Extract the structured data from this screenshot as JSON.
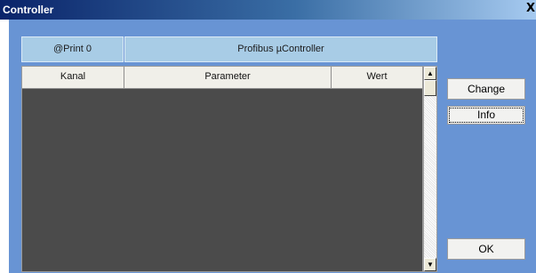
{
  "window": {
    "title": "Controller",
    "close_label": "X"
  },
  "info": {
    "print": "@Print 0",
    "controller": "Profibus µController"
  },
  "table": {
    "columns": [
      "Kanal",
      "Parameter",
      "Wert"
    ],
    "rows": []
  },
  "buttons": {
    "change": "Change",
    "info": "Info",
    "ok": "OK"
  },
  "icons": {
    "scroll_up": "scroll-up-arrow",
    "scroll_down": "scroll-down-arrow"
  },
  "colors": {
    "client_bg": "#6894d4",
    "grid_bg": "#4b4b4b",
    "info_bg": "#a8cce6"
  }
}
